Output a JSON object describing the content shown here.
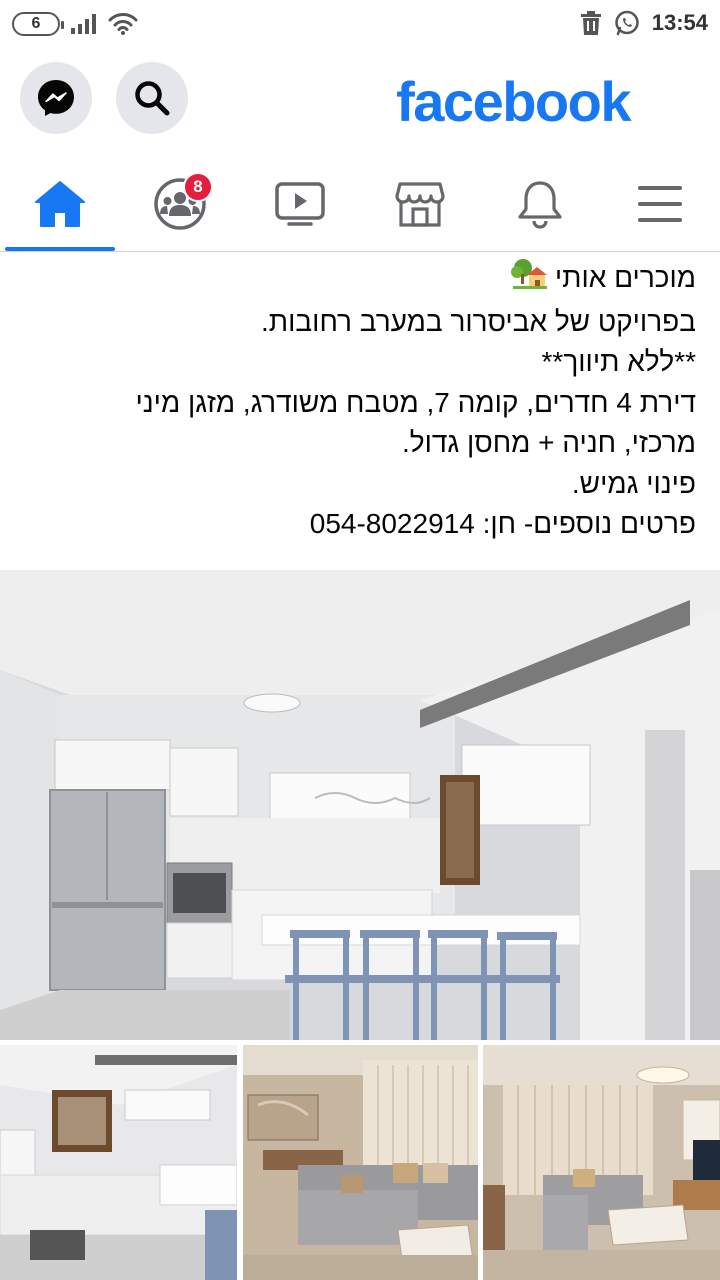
{
  "status_bar": {
    "battery_level": "6",
    "time": "13:54"
  },
  "header": {
    "logo": "facebook",
    "messenger_icon": "messenger-icon",
    "search_icon": "search-icon",
    "brand_color": "#1877f2"
  },
  "nav": {
    "tabs": [
      {
        "name": "home",
        "icon": "home-icon",
        "active": true
      },
      {
        "name": "groups",
        "icon": "groups-icon",
        "badge": "8"
      },
      {
        "name": "watch",
        "icon": "video-icon"
      },
      {
        "name": "marketplace",
        "icon": "marketplace-icon"
      },
      {
        "name": "notifications",
        "icon": "bell-icon"
      },
      {
        "name": "menu",
        "icon": "hamburger-icon"
      }
    ]
  },
  "post": {
    "lines": [
      "מוכרים אותי",
      "בפרויקט של אביסרור במערב רחובות.",
      "**ללא תיווך**",
      "דירת 4 חדרים, קומה 7, מטבח משודרג, מזגן מיני",
      "מרכזי, חניה + מחסן גדול.",
      "פינוי גמיש.",
      "פרטים נוספים- חן: 054-8022914"
    ],
    "photos": [
      {
        "name": "kitchen-main"
      },
      {
        "name": "kitchen-window"
      },
      {
        "name": "living-room-1"
      },
      {
        "name": "living-room-2"
      }
    ]
  }
}
